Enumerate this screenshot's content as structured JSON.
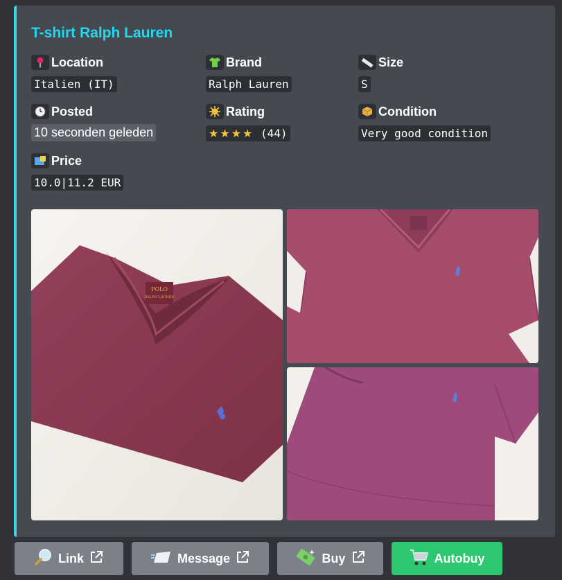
{
  "embed": {
    "title": "T-shirt Ralph Lauren",
    "accent_color": "#3fd6e6",
    "fields": {
      "location": {
        "name": "Location",
        "value": "Italien (IT)",
        "icon": "pin-icon"
      },
      "brand": {
        "name": "Brand",
        "value": "Ralph Lauren",
        "icon": "tshirt-icon"
      },
      "size": {
        "name": "Size",
        "value": "S",
        "icon": "ruler-icon"
      },
      "posted": {
        "name": "Posted",
        "value": "10 seconden geleden",
        "icon": "clock-icon"
      },
      "rating": {
        "name": "Rating",
        "stars": "★★★★",
        "star_count": 4,
        "count_text": "(44)",
        "icon": "sun-icon"
      },
      "condition": {
        "name": "Condition",
        "value": "Very good condition",
        "icon": "package-icon"
      },
      "price": {
        "name": "Price",
        "value": "10.0|11.2 EUR",
        "icon": "price-tag-icon"
      }
    },
    "photos": [
      {
        "label": "folded-tshirt-photo",
        "color": "#8a3a4f"
      },
      {
        "label": "tshirt-top-photo",
        "color": "#a24d6c"
      },
      {
        "label": "tshirt-side-photo",
        "color": "#9b4a77"
      }
    ],
    "logo_text": "POLO RALPH LAUREN"
  },
  "buttons": {
    "link": {
      "label": "Link",
      "icon": "magnifier-icon"
    },
    "message": {
      "label": "Message",
      "icon": "message-icon"
    },
    "buy": {
      "label": "Buy",
      "icon": "money-icon"
    },
    "autobuy": {
      "label": "Autobuy",
      "icon": "cart-icon",
      "color": "#2dc770"
    }
  }
}
